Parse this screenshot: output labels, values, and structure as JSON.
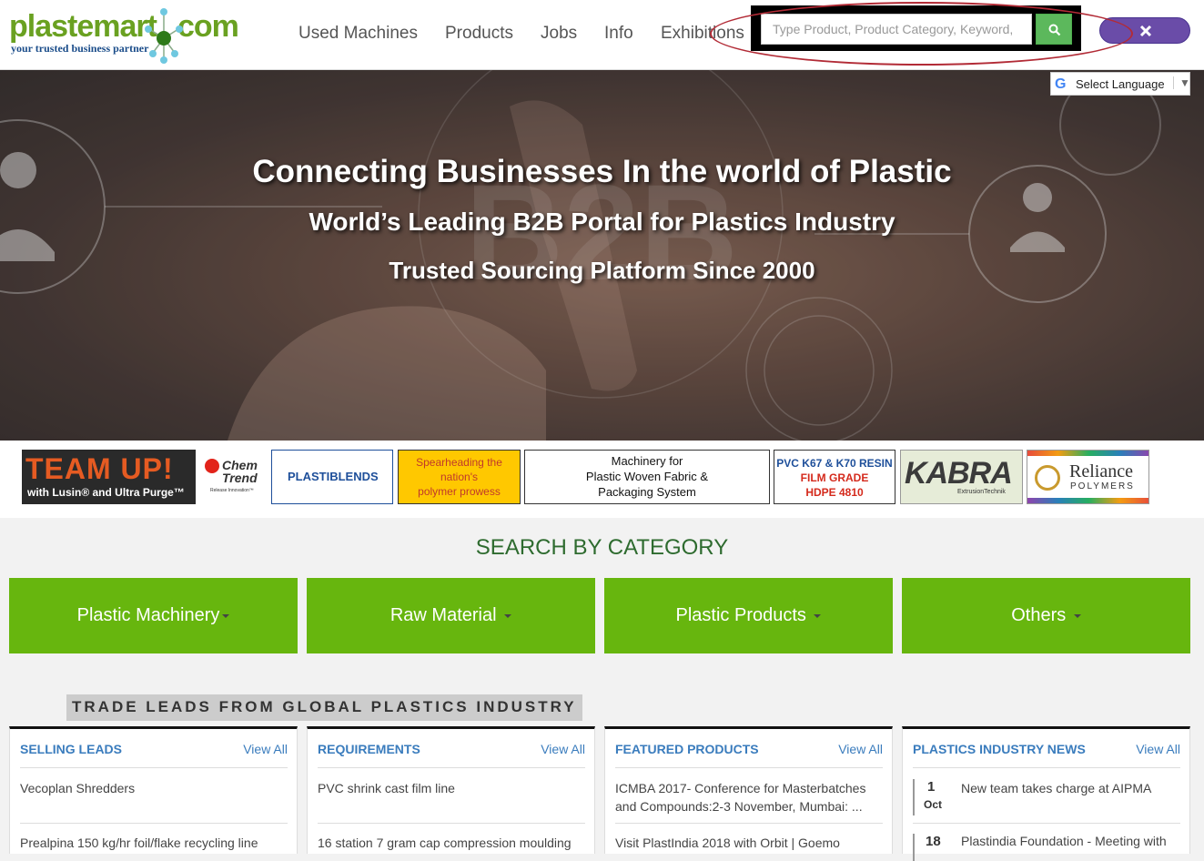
{
  "logo": {
    "brand_left": "plastemart",
    "brand_right": "com",
    "tagline": "your trusted business partner"
  },
  "nav": {
    "items": [
      "Used Machines",
      "Products",
      "Jobs",
      "Info",
      "Exhibitions"
    ]
  },
  "search": {
    "placeholder": "Type Product, Product Category, Keyword,",
    "button_icon": "search-icon"
  },
  "close_button": {
    "icon": "close-icon"
  },
  "language": {
    "label": "Select Language",
    "arrow": "▼",
    "logo": "G"
  },
  "hero": {
    "line1": "Connecting Businesses In the world of Plastic",
    "line2": "World’s Leading B2B Portal for Plastics Industry",
    "line3": "Trusted Sourcing Platform Since 2000",
    "bg_text": "B2B"
  },
  "ads": {
    "teamup": {
      "title": "TEAM UP!",
      "subtitle": "with Lusin® and Ultra Purge™"
    },
    "chemtrend": {
      "name1": "Chem",
      "name2": "Trend",
      "slogan": "Release Innovation™"
    },
    "plastiblends": {
      "name": "PLASTIBLENDS"
    },
    "spearheading": {
      "line1": "Spearheading the",
      "line2": "nation's",
      "line3": "polymer prowess"
    },
    "machinery": {
      "line1": "Machinery for",
      "line2": "Plastic Woven Fabric &",
      "line3": "Packaging System"
    },
    "pvc": {
      "line1": "PVC K67 & K70 RESIN",
      "line2": "FILM GRADE",
      "line3": "HDPE 4810"
    },
    "kabra": {
      "name": "KABRA",
      "sub": "ExtrusionTechnik"
    },
    "reliance": {
      "name": "Reliance",
      "sub": "POLYMERS"
    }
  },
  "category": {
    "title": "SEARCH BY CATEGORY",
    "buttons": [
      "Plastic Machinery",
      "Raw Material",
      "Plastic Products",
      "Others"
    ]
  },
  "trade_title": "TRADE LEADS FROM GLOBAL PLASTICS INDUSTRY",
  "panels": {
    "selling": {
      "title": "SELLING LEADS",
      "view": "View All",
      "item1": "Vecoplan Shredders",
      "item2": "Prealpina 150 kg/hr foil/flake recycling line"
    },
    "requirements": {
      "title": "REQUIREMENTS",
      "view": "View All",
      "item1": "PVC shrink cast film line",
      "item2": "16 station 7 gram cap compression moulding"
    },
    "featured": {
      "title": "FEATURED PRODUCTS",
      "view": "View All",
      "item1": "ICMBA 2017- Conference for Masterbatches and Compounds:2-3 November, Mumbai: ...",
      "item2": "Visit PlastIndia 2018 with Orbit | Goemo"
    },
    "news": {
      "title": "PLASTICS INDUSTRY NEWS",
      "view": "View All",
      "date1_day": "1",
      "date1_month": "Oct",
      "item1": "New team takes charge at AIPMA",
      "date2_day": "18",
      "item2": "Plastindia Foundation - Meeting with"
    }
  },
  "colors": {
    "brand_green": "#6aa121",
    "category_green": "#67b60e",
    "link_blue": "#3a7cbd",
    "search_green": "#5cb85c",
    "close_purple": "#6a4ca8",
    "highlight_red": "#b22b36"
  }
}
